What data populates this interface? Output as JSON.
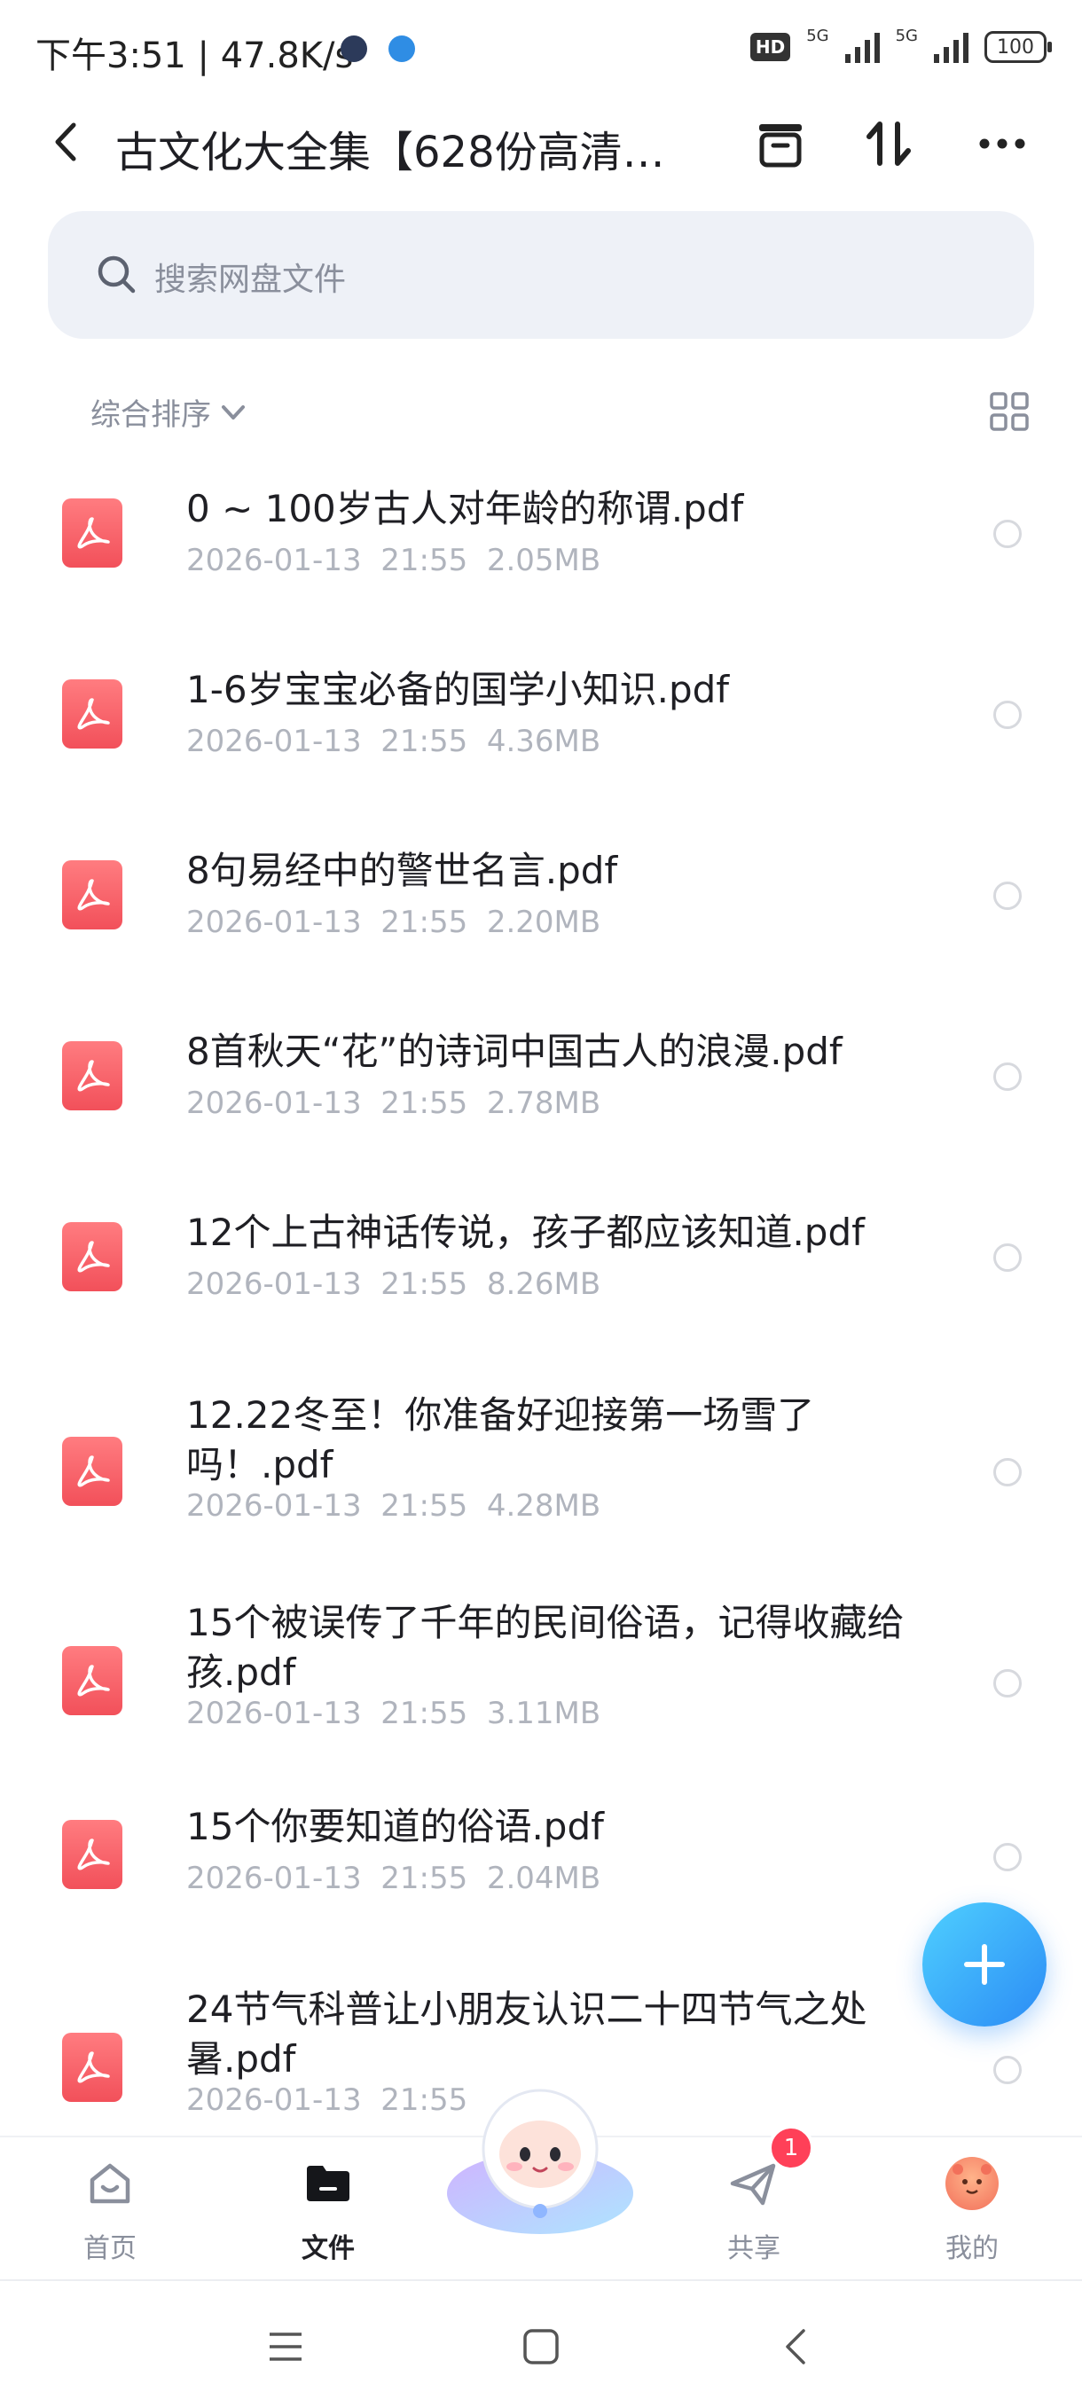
{
  "status_bar": {
    "time_speed": "下午3:51 | 47.8K/s",
    "hd": "HD",
    "net1": "5G",
    "net2": "5G",
    "battery": "100"
  },
  "header": {
    "title": "古文化大全集【628份高清…",
    "back_icon": "chevron-left-icon",
    "actions": [
      "archive-icon",
      "sort-icon",
      "more-icon"
    ]
  },
  "search": {
    "placeholder": "搜索网盘文件"
  },
  "sort": {
    "label": "综合排序"
  },
  "files": [
    {
      "name": "0 ~ 100岁古人对年龄的称谓.pdf",
      "date": "2026-01-13",
      "time": "21:55",
      "size": "2.05MB"
    },
    {
      "name": "1-6岁宝宝必备的国学小知识.pdf",
      "date": "2026-01-13",
      "time": "21:55",
      "size": "4.36MB"
    },
    {
      "name": "8句易经中的警世名言.pdf",
      "date": "2026-01-13",
      "time": "21:55",
      "size": "2.20MB"
    },
    {
      "name": "8首秋天“花”的诗词中国古人的浪漫.pdf",
      "date": "2026-01-13",
      "time": "21:55",
      "size": "2.78MB"
    },
    {
      "name": "12个上古神话传说，孩子都应该知道.pdf",
      "date": "2026-01-13",
      "time": "21:55",
      "size": "8.26MB"
    },
    {
      "name": "12.22冬至！你准备好迎接第一场雪了吗！.pdf",
      "date": "2026-01-13",
      "time": "21:55",
      "size": "4.28MB"
    },
    {
      "name": "15个被误传了千年的民间俗语，记得收藏给孩.pdf",
      "date": "2026-01-13",
      "time": "21:55",
      "size": "3.11MB"
    },
    {
      "name": "15个你要知道的俗语.pdf",
      "date": "2026-01-13",
      "time": "21:55",
      "size": "2.04MB"
    },
    {
      "name": "24节气科普让小朋友认识二十四节气之处暑.pdf",
      "date": "2026-01-13",
      "time": "21:55",
      "size": ""
    }
  ],
  "nav": [
    {
      "label": "首页",
      "icon": "home-icon"
    },
    {
      "label": "文件",
      "icon": "folder-icon"
    },
    {
      "label": "",
      "icon": "mascot-icon"
    },
    {
      "label": "共享",
      "icon": "share-icon",
      "badge": "1"
    },
    {
      "label": "我的",
      "icon": "avatar-icon"
    }
  ],
  "colors": {
    "pdf": "#f2505a",
    "fab": "#2b8bf5",
    "badge": "#ff4058"
  }
}
